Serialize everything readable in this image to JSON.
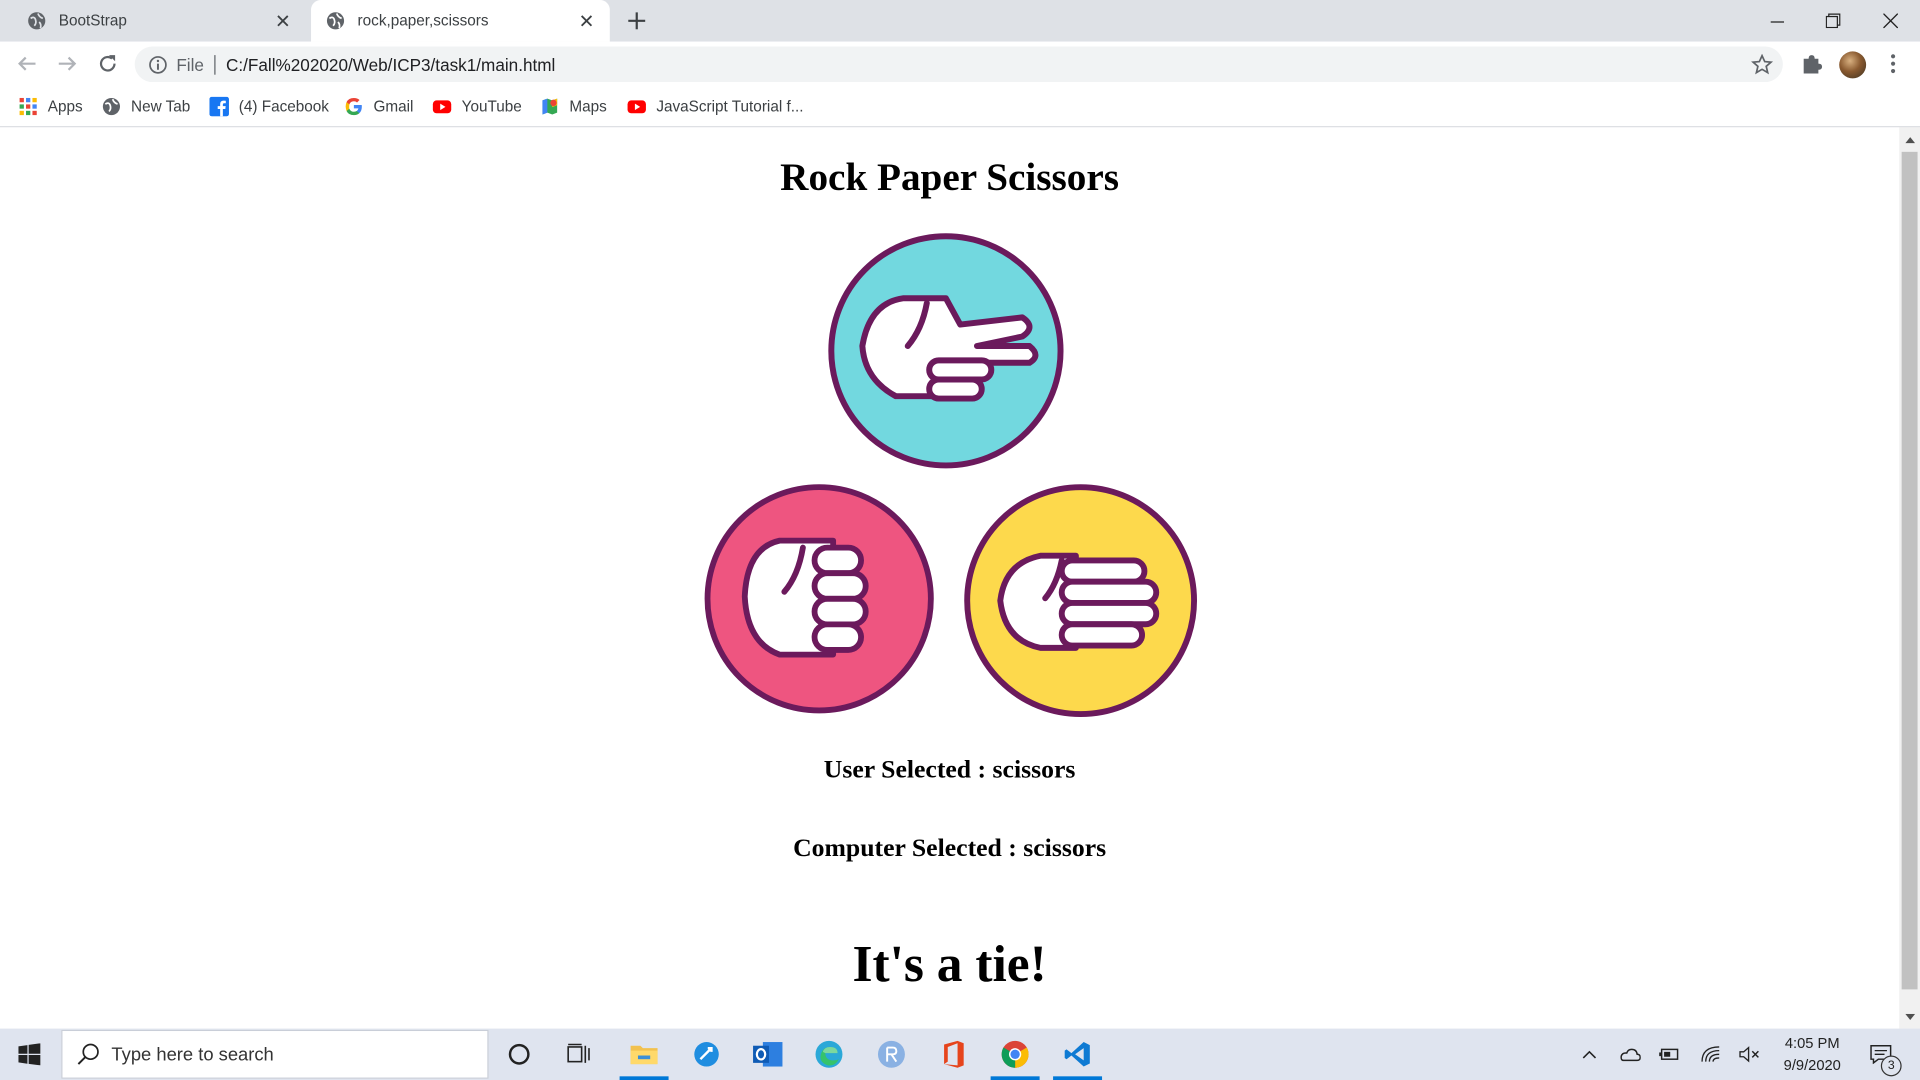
{
  "browser": {
    "tabs": [
      {
        "title": "BootStrap",
        "active": false
      },
      {
        "title": "rock,paper,scissors",
        "active": true
      }
    ],
    "address": {
      "scheme": "File",
      "url": "C:/Fall%202020/Web/ICP3/task1/main.html"
    },
    "bookmarks": [
      "Apps",
      "New Tab",
      "(4) Facebook",
      "Gmail",
      "YouTube",
      "Maps",
      "JavaScript Tutorial f..."
    ]
  },
  "page": {
    "title": "Rock Paper Scissors",
    "user_selected": "User Selected : scissors",
    "computer_selected": "Computer Selected : scissors",
    "result": "It's a tie!",
    "choices": [
      {
        "name": "scissors",
        "color": "#72d8df"
      },
      {
        "name": "rock",
        "color": "#ee5580"
      },
      {
        "name": "paper",
        "color": "#fdd94c"
      }
    ],
    "outline_color": "#6b1a5c"
  },
  "taskbar": {
    "search_placeholder": "Type here to search",
    "time": "4:05 PM",
    "date": "9/9/2020",
    "notification_count": "3"
  }
}
